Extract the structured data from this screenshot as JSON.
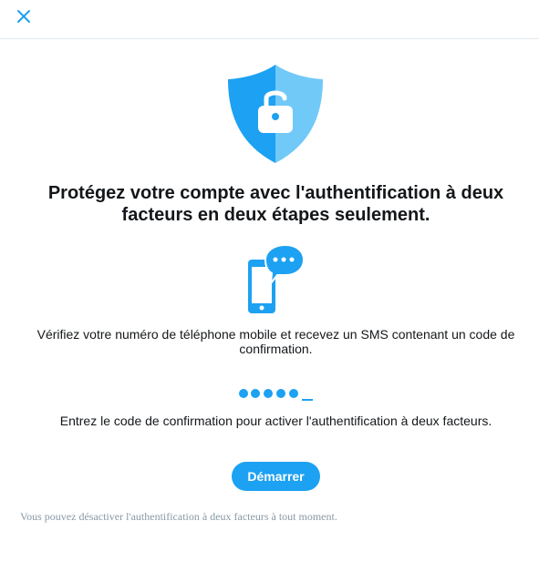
{
  "header": {
    "close_icon": "close-icon"
  },
  "colors": {
    "accent": "#1da1f2",
    "shield_dark": "#1da1f2",
    "shield_light": "#71c9f8",
    "text": "#14171a",
    "muted": "#8899a6",
    "divider": "#e1e8ed"
  },
  "hero": {
    "icon": "shield-lock-icon"
  },
  "title": "Protégez votre compte avec l'authentification à deux facteurs en deux étapes seulement.",
  "step1": {
    "icon": "phone-message-icon",
    "text": "Vérifiez votre numéro de téléphone mobile et recevez un SMS contenant un code de confirmation."
  },
  "step2": {
    "icon": "code-dots-icon",
    "text": "Entrez le code de confirmation pour activer l'authentification à deux facteurs."
  },
  "start_button": {
    "label": "Démarrer"
  },
  "footer_note": "Vous pouvez désactiver l'authentification à deux facteurs à tout moment."
}
